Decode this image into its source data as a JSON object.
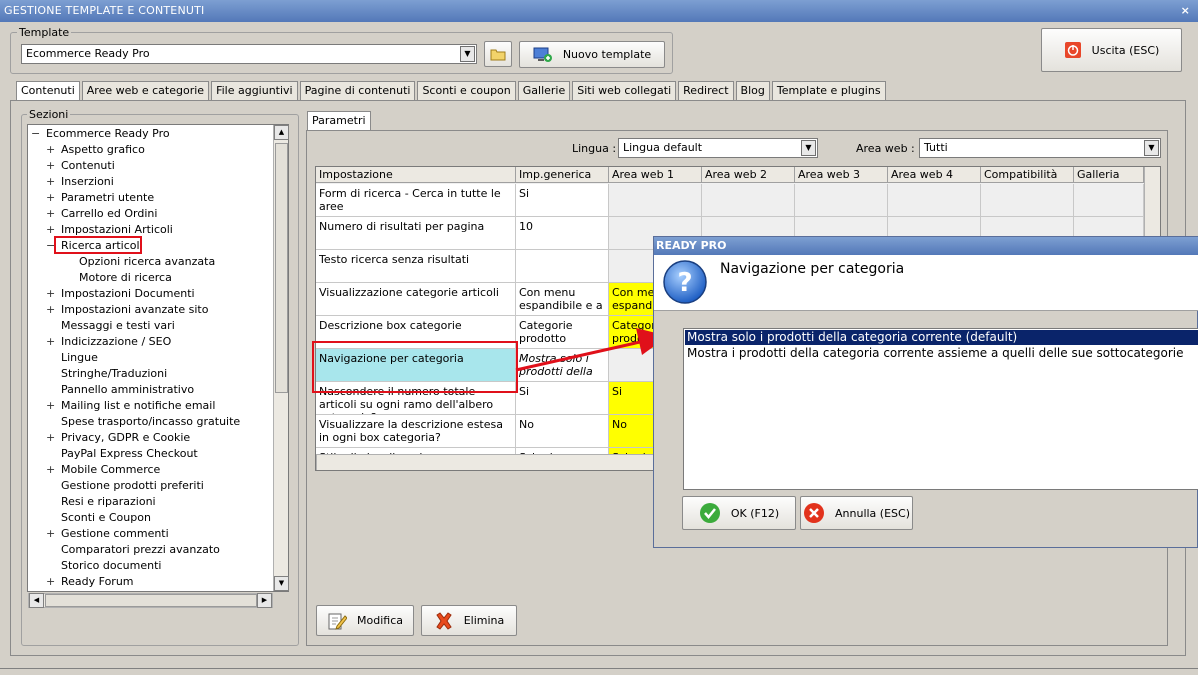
{
  "window": {
    "title": "GESTIONE TEMPLATE E CONTENUTI",
    "close": "×"
  },
  "template": {
    "legend": "Template",
    "selected": "Ecommerce Ready Pro",
    "new_button": "Nuovo template",
    "exit_button": "Uscita (ESC)"
  },
  "tabs": [
    "Contenuti",
    "Aree web e categorie",
    "File aggiuntivi",
    "Pagine di contenuti",
    "Sconti e coupon",
    "Gallerie",
    "Siti web collegati",
    "Redirect",
    "Blog",
    "Template e plugins"
  ],
  "sections": {
    "legend": "Sezioni",
    "items": [
      {
        "pm": "−",
        "label": "Ecommerce Ready Pro",
        "level": 0
      },
      {
        "pm": "+",
        "label": "Aspetto grafico",
        "level": 1
      },
      {
        "pm": "+",
        "label": "Contenuti",
        "level": 1
      },
      {
        "pm": "+",
        "label": "Inserzioni",
        "level": 1
      },
      {
        "pm": "+",
        "label": "Parametri utente",
        "level": 1
      },
      {
        "pm": "+",
        "label": "Carrello ed Ordini",
        "level": 1
      },
      {
        "pm": "+",
        "label": "Impostazioni Articoli",
        "level": 1
      },
      {
        "pm": "−",
        "label": "Ricerca articoli",
        "level": 1
      },
      {
        "pm": "",
        "label": "Opzioni ricerca avanzata",
        "level": 2
      },
      {
        "pm": "",
        "label": "Motore di ricerca",
        "level": 2
      },
      {
        "pm": "+",
        "label": "Impostazioni Documenti",
        "level": 1
      },
      {
        "pm": "+",
        "label": "Impostazioni avanzate sito",
        "level": 1
      },
      {
        "pm": "",
        "label": "Messaggi e testi vari",
        "level": 1
      },
      {
        "pm": "+",
        "label": "Indicizzazione / SEO",
        "level": 1
      },
      {
        "pm": "",
        "label": "Lingue",
        "level": 1
      },
      {
        "pm": "",
        "label": "Stringhe/Traduzioni",
        "level": 1
      },
      {
        "pm": "",
        "label": "Pannello amministrativo",
        "level": 1
      },
      {
        "pm": "+",
        "label": "Mailing list e notifiche email",
        "level": 1
      },
      {
        "pm": "",
        "label": "Spese trasporto/incasso gratuite",
        "level": 1
      },
      {
        "pm": "+",
        "label": "Privacy, GDPR e Cookie",
        "level": 1
      },
      {
        "pm": "",
        "label": "PayPal Express Checkout",
        "level": 1
      },
      {
        "pm": "+",
        "label": "Mobile Commerce",
        "level": 1
      },
      {
        "pm": "",
        "label": "Gestione prodotti preferiti",
        "level": 1
      },
      {
        "pm": "",
        "label": "Resi e riparazioni",
        "level": 1
      },
      {
        "pm": "",
        "label": "Sconti e Coupon",
        "level": 1
      },
      {
        "pm": "+",
        "label": "Gestione commenti",
        "level": 1
      },
      {
        "pm": "",
        "label": "Comparatori prezzi avanzato",
        "level": 1
      },
      {
        "pm": "",
        "label": "Storico documenti",
        "level": 1
      },
      {
        "pm": "+",
        "label": "Ready Forum",
        "level": 1
      }
    ]
  },
  "params": {
    "tab": "Parametri",
    "lingua_label": "Lingua :",
    "lingua_value": "Lingua default",
    "area_label": "Area web :",
    "area_value": "Tutti",
    "columns": [
      "Impostazione",
      "Imp.generica",
      "Area web 1",
      "Area web 2",
      "Area web 3",
      "Area web 4",
      "Compatibilità",
      "Galleria"
    ],
    "rows": [
      {
        "name": "Form di ricerca - Cerca in tutte le aree",
        "generic": "Si",
        "area1": "",
        "h": 33
      },
      {
        "name": "Numero di risultati per pagina",
        "generic": "10",
        "area1": "",
        "h": 33
      },
      {
        "name": "Testo ricerca senza risultati",
        "generic": "",
        "area1": "",
        "h": 33
      },
      {
        "name": "Visualizzazione categorie articoli",
        "generic": "Con menu espandibile e a ...",
        "area1": "Con menu espandibi",
        "h": 33
      },
      {
        "name": "Descrizione box categorie",
        "generic": "Categorie prodotto",
        "area1": "Categorie prodotto",
        "h": 33
      },
      {
        "name": "Navigazione per categoria",
        "generic": "Mostra solo i prodotti della c...",
        "area1": "",
        "h": 33
      },
      {
        "name": "Nascondere il numero totale articoli su ogni ramo dell'albero categorie?",
        "generic": "Si",
        "area1": "Si",
        "h": 33
      },
      {
        "name": "Visualizzare la descrizione estesa in ogni box categoria?",
        "generic": "No",
        "area1": "No",
        "h": 33
      },
      {
        "name": "Stile di visualizzazione",
        "generic": "Schede",
        "area1": "Schede",
        "h": 33
      }
    ],
    "modify_button": "Modifica",
    "delete_button": "Elimina"
  },
  "dialog": {
    "title": "READY PRO",
    "heading": "Navigazione per categoria",
    "options": [
      "Mostra solo i prodotti della categoria corrente (default)",
      "Mostra i prodotti della categoria corrente assieme a quelli delle sue sottocategorie"
    ],
    "ok_button": "OK (F12)",
    "cancel_button": "Annulla (ESC)"
  },
  "colors": {
    "highlight_yellow": "#ffff00",
    "selected_cell": "#a8e6ec",
    "annotation_red": "#e0101a",
    "list_selection": "#0a246a"
  }
}
